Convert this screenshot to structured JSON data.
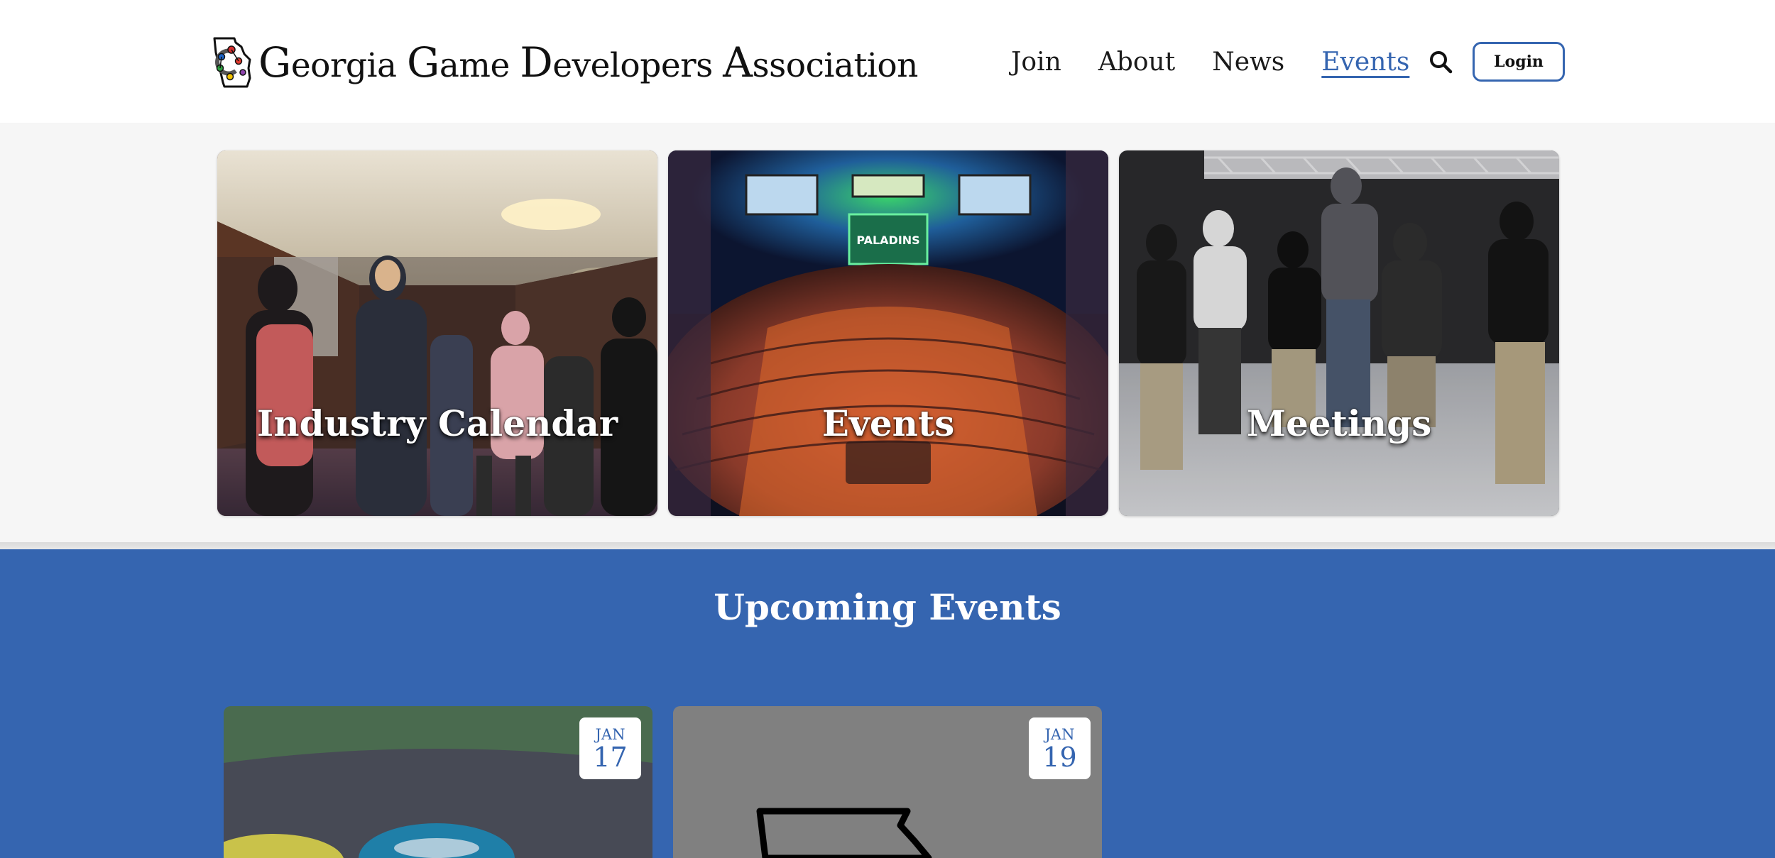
{
  "site": {
    "name_parts": [
      "G",
      "eorgia ",
      "G",
      "ame ",
      "D",
      "evelopers ",
      "A",
      "ssociation"
    ]
  },
  "nav": {
    "items": [
      {
        "label": "Join"
      },
      {
        "label": "About"
      },
      {
        "label": "News"
      },
      {
        "label": "Events",
        "active": true
      }
    ],
    "login_label": "Login"
  },
  "tiles": [
    {
      "label": "Industry Calendar"
    },
    {
      "label": "Events",
      "screen_text": "PALADINS"
    },
    {
      "label": "Meetings"
    }
  ],
  "events": {
    "title": "Upcoming Events",
    "cards": [
      {
        "month": "JAN",
        "day": "17"
      },
      {
        "month": "JAN",
        "day": "19"
      }
    ]
  },
  "colors": {
    "accent": "#3565b0",
    "band_background": "#f6f6f6",
    "events_background": "#3565b0"
  }
}
